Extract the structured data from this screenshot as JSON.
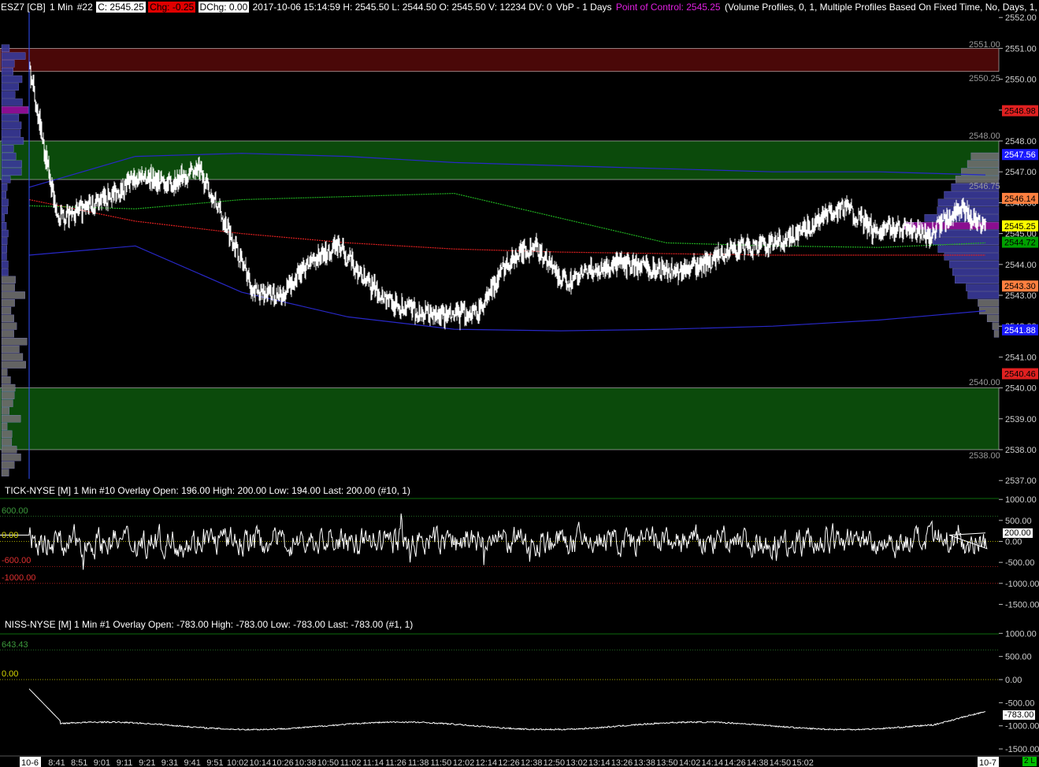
{
  "main_header": {
    "symbol": "ESZ7 [CB]",
    "interval": "1 Min",
    "chart_no": "#22",
    "close": "C: 2545.25",
    "chg": "Chg: -0.25",
    "dchg": "DChg: 0.00",
    "details": "2017-10-06 15:14:59 H: 2545.50 L: 2544.50 O: 2545.50 V: 12234 DV: 0",
    "vbp": "VbP - 1 Days",
    "poc": "Point of Control: 2545.25",
    "study": "(Volume Profiles, 0, 1, Multiple Profiles Based On Fixed Time, No, Days, 1, 50, 1"
  },
  "tick_header": {
    "text": "TICK-NYSE [M]   1 Min   #10 Overlay   Open: 196.00   High: 200.00   Low: 194.00   Last: 200.00   (#10, 1)"
  },
  "niss_header": {
    "text": "NISS-NYSE [M]   1 Min   #1 Overlay   Open: -783.00   High: -783.00   Low: -783.00   Last: -783.00   (#1, 1)"
  },
  "zone_labels": {
    "z1_top": "2551.00",
    "z1_bottom": "2550.25",
    "z2_top": "2548.00",
    "z2_bottom": "2546.75",
    "z3_top": "2540.00",
    "z3_bottom": "2538.00"
  },
  "price_tags": [
    {
      "text": "2548.98",
      "value": 2548.98,
      "bg": "#e02020",
      "fg": "#000000"
    },
    {
      "text": "2547.56",
      "value": 2547.56,
      "bg": "#1a1aff",
      "fg": "#ffffff"
    },
    {
      "text": "2546.14",
      "value": 2546.14,
      "bg": "#ff8040",
      "fg": "#000000"
    },
    {
      "text": "2545.25",
      "value": 2545.25,
      "bg": "#ffff00",
      "fg": "#000000"
    },
    {
      "text": "2544.72",
      "value": 2544.72,
      "bg": "#00a000",
      "fg": "#000000"
    },
    {
      "text": "2543.30",
      "value": 2543.3,
      "bg": "#ff8040",
      "fg": "#000000"
    },
    {
      "text": "2541.88",
      "value": 2541.88,
      "bg": "#1a1aff",
      "fg": "#ffffff"
    },
    {
      "text": "2540.46",
      "value": 2540.46,
      "bg": "#e02020",
      "fg": "#000000"
    }
  ],
  "tick_levels": {
    "l600": "600.00",
    "l0": "0.00",
    "lm600": "-600.00",
    "lm1000": "-1000.00",
    "last": "200.00"
  },
  "niss_levels": {
    "l643": "643.43",
    "l0": "0.00",
    "last": "-783.00"
  },
  "chart_data": [
    {
      "type": "line",
      "name": "ESZ7 price",
      "x": [
        "10-6",
        "8:41",
        "8:51",
        "9:01",
        "9:11",
        "9:21",
        "9:31",
        "9:41",
        "9:51",
        "10:02",
        "10:14",
        "10:26",
        "10:38",
        "10:50",
        "11:02",
        "11:14",
        "11:26",
        "11:38",
        "11:50",
        "12:02",
        "12:14",
        "12:26",
        "12:38",
        "12:50",
        "13:02",
        "13:14",
        "13:26",
        "13:38",
        "13:50",
        "14:02",
        "14:14",
        "14:26",
        "14:38",
        "14:50",
        "15:02"
      ],
      "y": [
        2550.4,
        2545.5,
        2545.8,
        2546.3,
        2546.9,
        2546.6,
        2547.1,
        2545.3,
        2543.1,
        2543.0,
        2544.1,
        2544.6,
        2543.4,
        2542.7,
        2542.4,
        2542.3,
        2542.5,
        2544.1,
        2544.6,
        2543.4,
        2543.8,
        2544.0,
        2543.9,
        2543.8,
        2544.0,
        2544.5,
        2544.6,
        2544.8,
        2545.4,
        2545.9,
        2545.1,
        2545.2,
        2544.9,
        2545.8,
        2545.25
      ],
      "yticks": [
        "2537.00",
        "2538.00",
        "2539.00",
        "2540.00",
        "2541.00",
        "2542.00",
        "2543.00",
        "2544.00",
        "2545.00",
        "2546.00",
        "2547.00",
        "2548.00",
        "2549.00",
        "2550.00",
        "2551.00",
        "2552.00"
      ],
      "ylim": [
        2537,
        2552.4
      ],
      "zones": [
        {
          "low": 2550.25,
          "high": 2551.0,
          "color": "#4a0808"
        },
        {
          "low": 2546.75,
          "high": 2548.0,
          "color": "#0b4a0b"
        },
        {
          "low": 2538.0,
          "high": 2540.0,
          "color": "#0b4a0b"
        }
      ],
      "vwap_red": [
        2546.1,
        2545.4,
        2545.0,
        2544.7,
        2544.5,
        2544.4,
        2544.35,
        2544.3,
        2544.3,
        2544.3
      ],
      "band_upper_blue": [
        2546.5,
        2547.5,
        2547.6,
        2547.5,
        2547.3,
        2547.2,
        2547.1,
        2547.0,
        2547.0,
        2546.9
      ],
      "band_lower_blue": [
        2544.3,
        2544.6,
        2543.1,
        2542.3,
        2541.9,
        2541.85,
        2541.9,
        2542.0,
        2542.2,
        2542.5
      ],
      "green_line": [
        2545.9,
        2545.8,
        2546.1,
        2546.2,
        2546.3,
        2545.5,
        2544.7,
        2544.6,
        2544.55,
        2544.7
      ],
      "point_of_control": 2545.25,
      "grid": false
    },
    {
      "type": "line",
      "name": "TICK-NYSE",
      "yticks": [
        "1000.00",
        "500.00",
        "0.00",
        "-500.00",
        "-1000.00",
        "-1500.00"
      ],
      "ylim": [
        -1550,
        1050
      ],
      "levels": [
        600,
        0,
        -600,
        -1000
      ],
      "last": 200
    },
    {
      "type": "line",
      "name": "NISS-NYSE",
      "yticks": [
        "1000.00",
        "500.00",
        "0.00",
        "-500.00",
        "-1000.00",
        "-1500.00"
      ],
      "ylim": [
        -1550,
        1050
      ],
      "levels": [
        643.43,
        0
      ],
      "y_start": -200,
      "y_level": -1000,
      "last": -783
    }
  ],
  "x_labels": [
    "10-6",
    "8:41",
    "8:51",
    "9:01",
    "9:11",
    "9:21",
    "9:31",
    "9:41",
    "9:51",
    "10:02",
    "10:14",
    "10:26",
    "10:38",
    "10:50",
    "11:02",
    "11:14",
    "11:26",
    "11:38",
    "11:50",
    "12:02",
    "12:14",
    "12:26",
    "12:38",
    "12:50",
    "13:02",
    "13:14",
    "13:26",
    "13:38",
    "13:50",
    "14:02",
    "14:14",
    "14:26",
    "14:38",
    "14:50",
    "15:02",
    "10-7"
  ],
  "corner_badge": "2 L",
  "colors": {
    "background": "#000000",
    "zone_red": "#4a0808",
    "zone_green": "#0b4a0b",
    "profile_blue": "#3a3a9a",
    "profile_gray": "#6e6e6e",
    "poc_magenta": "#9a10a0",
    "header_poc": "#e020e0",
    "chg_red": "#e00000"
  }
}
